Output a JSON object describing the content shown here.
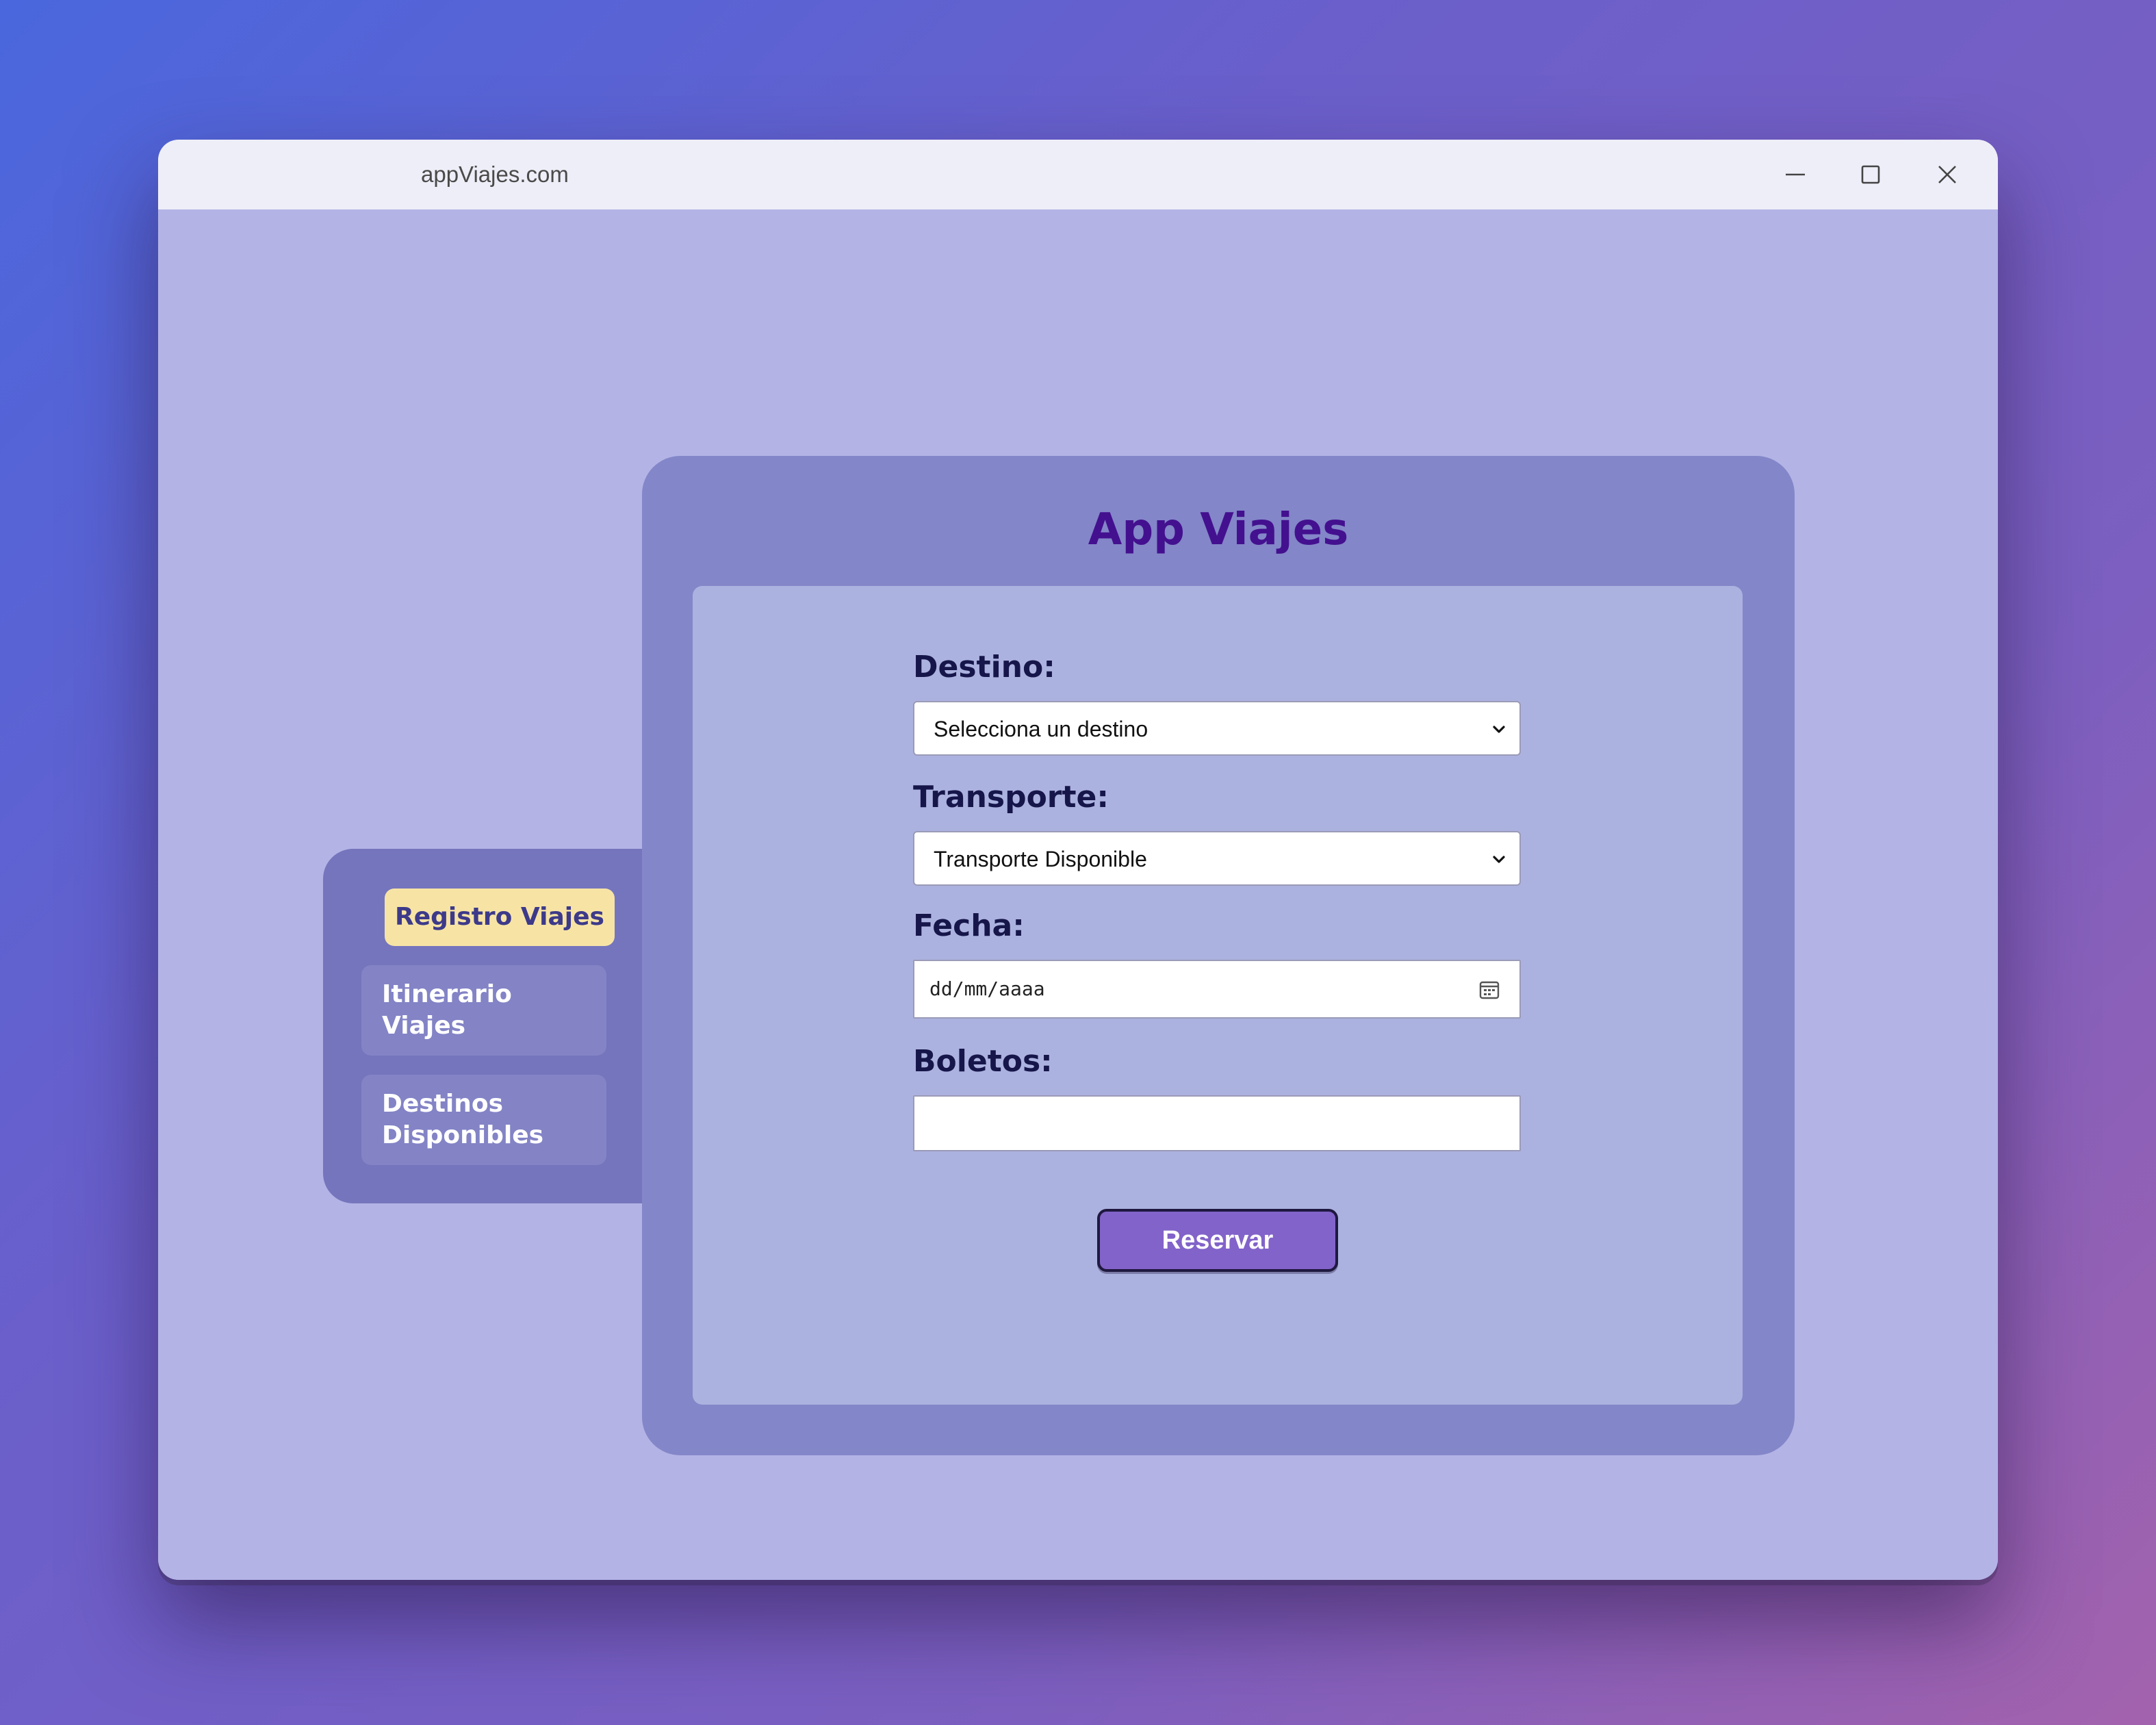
{
  "window": {
    "title": "appViajes.com",
    "controls": {
      "minimize": "minimize-icon",
      "maximize": "maximize-icon",
      "close": "close-icon"
    }
  },
  "sidebar": {
    "items": [
      {
        "label": "Registro Viajes",
        "active": true
      },
      {
        "label": "Itinerario Viajes",
        "active": false
      },
      {
        "label": "Destinos Disponibles",
        "active": false
      }
    ]
  },
  "main": {
    "title": "App Viajes",
    "form": {
      "destino": {
        "label": "Destino:",
        "selected": "Selecciona un destino"
      },
      "transporte": {
        "label": "Transporte:",
        "selected": "Transporte Disponible"
      },
      "fecha": {
        "label": "Fecha:",
        "placeholder": "dd/mm/aaaa",
        "icon": "calendar-icon"
      },
      "boletos": {
        "label": "Boletos:",
        "value": ""
      },
      "submit_label": "Reservar"
    }
  },
  "colors": {
    "background_gradient_start": "#4a67dd",
    "background_gradient_end": "#a362ad",
    "content_bg": "#b3b3e6",
    "card_bg": "#8386c8",
    "panel_bg": "#acb2df",
    "sidebar_bg": "#7575bd",
    "nav_active_bg": "#f7e4a5",
    "title_color": "#43108f",
    "button_bg": "#8263c9"
  }
}
